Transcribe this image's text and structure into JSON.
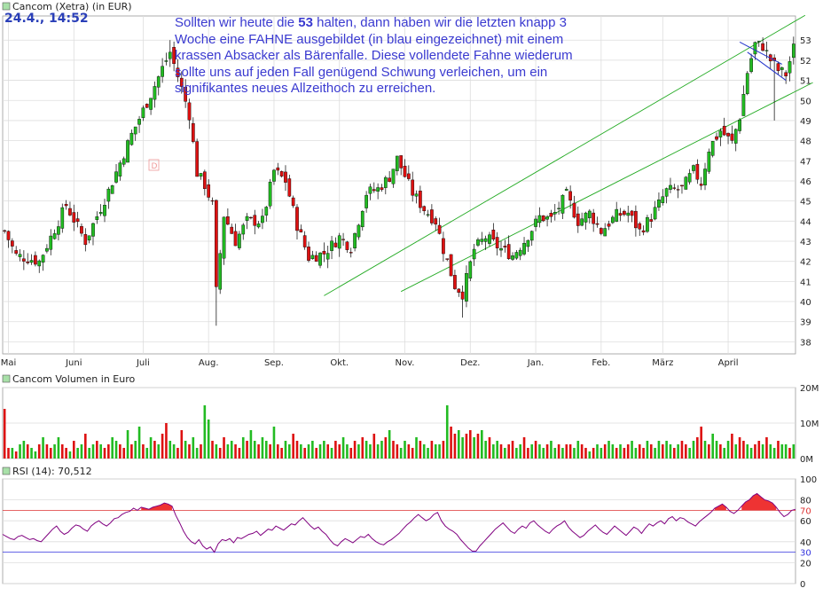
{
  "stamp": "24.4., 14:52",
  "annotation": {
    "before": "Sollten wir heute die ",
    "bold": "53",
    "after": " halten, dann haben wir die letzten knapp 3 Woche eine FAHNE ausgebildet (in blau eingezeichnet) mit einem krassen Absacker als Bärenfalle. Diese vollendete Fahne wiederum sollte uns auf jeden Fall genügend Schwung verleichen, um ein signifikantes neues Allzeithoch zu erreichen."
  },
  "colors": {
    "up": "#22bb22",
    "down": "#dd1111",
    "grid": "#dddddd",
    "frame": "#999999",
    "trend": "#22aa22",
    "flag": "#2233cc",
    "rsi_line": "#800080",
    "rsi_upper": "#dd3333",
    "rsi_lower": "#3333dd",
    "rsi_fill": "#ee3333"
  },
  "chart_data": [
    {
      "type": "candlestick",
      "panel": "price",
      "legend": "Cancom (Xetra) (in EUR)",
      "months": [
        "Mai",
        "Juni",
        "Juli",
        "Aug.",
        "Sep.",
        "Okt.",
        "Nov.",
        "Dez.",
        "Jan.",
        "Feb.",
        "März",
        "April"
      ],
      "yticks": [
        38,
        39,
        40,
        41,
        42,
        43,
        44,
        45,
        46,
        47,
        48,
        49,
        50,
        51,
        52,
        53
      ],
      "ylim": [
        37.4,
        54.2
      ],
      "anchors": [
        [
          0,
          43.5
        ],
        [
          3,
          42.3
        ],
        [
          9,
          42.0
        ],
        [
          16,
          44.8
        ],
        [
          21,
          43.0
        ],
        [
          27,
          45.5
        ],
        [
          33,
          48.3
        ],
        [
          38,
          50.3
        ],
        [
          41,
          51.6
        ],
        [
          43,
          52.4
        ],
        [
          46,
          50.6
        ],
        [
          48,
          49.3
        ],
        [
          50,
          46.4
        ],
        [
          52,
          45.8
        ],
        [
          54,
          44.8
        ],
        [
          55,
          40.5
        ],
        [
          57,
          44.3
        ],
        [
          60,
          43.0
        ],
        [
          63,
          44.0
        ],
        [
          67,
          44.0
        ],
        [
          70,
          46.5
        ],
        [
          73,
          46.0
        ],
        [
          76,
          43.8
        ],
        [
          79,
          42.2
        ],
        [
          83,
          42.4
        ],
        [
          87,
          43.2
        ],
        [
          90,
          42.7
        ],
        [
          94,
          45.4
        ],
        [
          97,
          45.6
        ],
        [
          100,
          46.2
        ],
        [
          102,
          47.1
        ],
        [
          106,
          45.4
        ],
        [
          109,
          44.6
        ],
        [
          112,
          44.0
        ],
        [
          114,
          42.6
        ],
        [
          117,
          40.8
        ],
        [
          119,
          40.4
        ],
        [
          122,
          42.6
        ],
        [
          125,
          43.2
        ],
        [
          129,
          42.6
        ],
        [
          132,
          42.3
        ],
        [
          135,
          43.0
        ],
        [
          139,
          44.2
        ],
        [
          142,
          44.1
        ],
        [
          146,
          45.3
        ],
        [
          149,
          44.0
        ],
        [
          152,
          44.4
        ],
        [
          155,
          43.5
        ],
        [
          159,
          44.3
        ],
        [
          162,
          44.4
        ],
        [
          165,
          43.5
        ],
        [
          168,
          44.2
        ],
        [
          172,
          45.5
        ],
        [
          176,
          45.6
        ],
        [
          179,
          46.5
        ],
        [
          181,
          45.9
        ],
        [
          183,
          47.6
        ],
        [
          186,
          48.5
        ],
        [
          189,
          47.9
        ],
        [
          191,
          49.2
        ],
        [
          193,
          51.4
        ],
        [
          195,
          52.8
        ],
        [
          197,
          52.7
        ],
        [
          199,
          52.0
        ],
        [
          201,
          51.5
        ],
        [
          203,
          51.3
        ],
        [
          205,
          52.6
        ]
      ],
      "candle_count": 206,
      "flag_high_lows": [
        [
          0,
          53.1
        ]
      ],
      "trend_channel": {
        "upper": [
          [
            127,
            45.2
          ],
          [
            205,
            53.9
          ]
        ],
        "lower": [
          [
            103,
            40.5
          ],
          [
            206,
            50.5
          ]
        ]
      },
      "flag": {
        "upper": [
          [
            191,
            52.9
          ],
          [
            202,
            51.8
          ]
        ],
        "lower": [
          [
            193,
            52.4
          ],
          [
            203,
            51.0
          ]
        ]
      }
    },
    {
      "type": "bar",
      "panel": "volume",
      "legend": "Cancom Volumen in Euro",
      "yticks": [
        "0M",
        "10M",
        "20M"
      ],
      "ylim": [
        0,
        20
      ],
      "values": [
        14,
        3,
        3,
        2,
        4,
        5,
        4,
        3,
        2,
        4,
        6,
        4,
        3,
        4,
        6,
        4,
        3,
        2,
        5,
        3,
        4,
        7,
        3,
        4,
        5,
        4,
        3,
        4,
        6,
        5,
        4,
        3,
        8,
        4,
        5,
        9,
        4,
        3,
        6,
        5,
        4,
        7,
        10,
        5,
        4,
        3,
        8,
        5,
        4,
        6,
        3,
        4,
        15,
        11,
        5,
        4,
        3,
        6,
        4,
        5,
        4,
        3,
        6,
        5,
        8,
        5,
        4,
        6,
        5,
        4,
        9,
        4,
        3,
        5,
        4,
        7,
        5,
        4,
        3,
        4,
        5,
        3,
        4,
        5,
        4,
        3,
        5,
        4,
        6,
        4,
        3,
        5,
        4,
        6,
        5,
        4,
        7,
        4,
        5,
        6,
        8,
        5,
        4,
        3,
        5,
        4,
        3,
        6,
        5,
        4,
        3,
        5,
        4,
        4,
        5,
        15,
        9,
        7,
        8,
        6,
        7,
        8,
        6,
        7,
        8,
        5,
        6,
        4,
        5,
        4,
        3,
        4,
        5,
        3,
        4,
        6,
        3,
        4,
        5,
        4,
        3,
        4,
        5,
        3,
        4,
        3,
        4,
        4,
        3,
        5,
        4,
        3,
        2,
        3,
        4,
        3,
        4,
        5,
        4,
        3,
        4,
        3,
        4,
        5,
        3,
        4,
        3,
        5,
        4,
        3,
        5,
        4,
        5,
        4,
        3,
        4,
        5,
        4,
        3,
        5,
        6,
        9,
        5,
        4,
        7,
        5,
        4,
        3,
        5,
        7,
        4,
        6,
        5,
        4,
        3,
        4,
        5,
        4,
        6,
        4,
        3,
        5,
        4,
        4,
        3,
        4
      ]
    },
    {
      "type": "line",
      "panel": "rsi",
      "legend": "RSI (14): 70,512",
      "yticks": [
        0,
        20,
        40,
        60,
        80,
        100
      ],
      "ylim": [
        0,
        100
      ],
      "ref_lines": [
        70,
        30
      ],
      "ref_labels": [
        "70",
        "30"
      ],
      "values": [
        47,
        45,
        43,
        42,
        45,
        46,
        44,
        42,
        43,
        41,
        40,
        44,
        48,
        52,
        55,
        50,
        47,
        49,
        53,
        56,
        55,
        52,
        50,
        55,
        58,
        60,
        57,
        55,
        58,
        62,
        63,
        66,
        68,
        69,
        72,
        70,
        73,
        72,
        71,
        73,
        74,
        75,
        77,
        76,
        74,
        65,
        58,
        50,
        44,
        40,
        38,
        42,
        36,
        33,
        35,
        30,
        38,
        42,
        41,
        43,
        39,
        44,
        43,
        45,
        47,
        48,
        50,
        46,
        49,
        52,
        51,
        55,
        53,
        51,
        54,
        57,
        56,
        60,
        63,
        59,
        55,
        52,
        54,
        50,
        47,
        42,
        38,
        36,
        40,
        43,
        41,
        39,
        42,
        45,
        44,
        47,
        43,
        40,
        38,
        37,
        40,
        42,
        45,
        48,
        52,
        56,
        59,
        63,
        66,
        63,
        60,
        62,
        66,
        68,
        60,
        55,
        52,
        50,
        47,
        42,
        38,
        34,
        31,
        31,
        36,
        40,
        44,
        48,
        52,
        55,
        58,
        54,
        50,
        48,
        52,
        55,
        53,
        58,
        60,
        56,
        53,
        50,
        48,
        52,
        55,
        57,
        60,
        54,
        50,
        47,
        44,
        46,
        50,
        53,
        56,
        52,
        49,
        47,
        51,
        55,
        52,
        49,
        46,
        50,
        54,
        52,
        48,
        53,
        57,
        55,
        58,
        60,
        57,
        62,
        64,
        60,
        63,
        62,
        59,
        57,
        55,
        59,
        62,
        65,
        68,
        72,
        74,
        76,
        73,
        69,
        67,
        70,
        74,
        78,
        80,
        84,
        86,
        83,
        80,
        79,
        77,
        73,
        68,
        64,
        66,
        70,
        71
      ]
    }
  ]
}
